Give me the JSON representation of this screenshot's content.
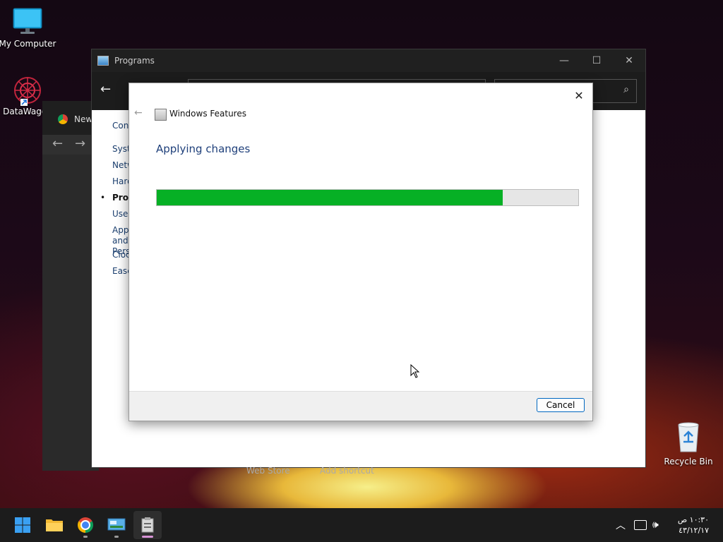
{
  "desktop": {
    "icons": [
      {
        "label": "My Computer"
      },
      {
        "label": "DataWagon"
      },
      {
        "label": "Recycle Bin"
      }
    ]
  },
  "chrome_window": {
    "tab_label": "New"
  },
  "programs_window": {
    "title": "Programs",
    "sidebar": [
      {
        "label": "Control Panel Home"
      },
      {
        "label": "System and Security"
      },
      {
        "label": "Network and Internet"
      },
      {
        "label": "Hardware and Sound"
      },
      {
        "label": "Programs"
      },
      {
        "label": "User Accounts"
      },
      {
        "label": "Appearance and Personalization"
      },
      {
        "label": "Clock and Region"
      },
      {
        "label": "Ease of Access"
      }
    ],
    "footer_links": [
      "Web Store",
      "Add shortcut"
    ]
  },
  "dialog": {
    "title": "Windows Features",
    "heading": "Applying changes",
    "progress_percent": 82,
    "cancel_label": "Cancel"
  },
  "taskbar": {
    "time": "١٠:٣٠ ص",
    "date": "٤٣/١٢/١٧"
  },
  "colors": {
    "progress_fill": "#06b025",
    "accent": "#0067c0",
    "heading": "#1e3f7a"
  }
}
